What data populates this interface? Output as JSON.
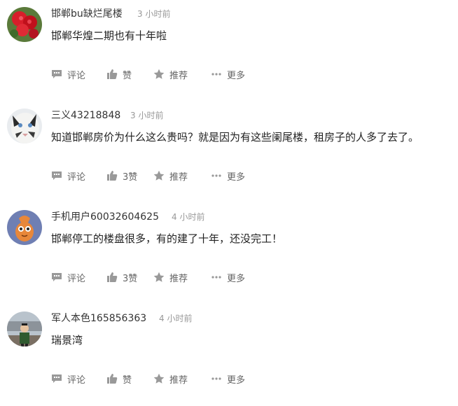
{
  "comments": [
    {
      "username": "邯郸bu缺烂尾楼",
      "time": "3 小时前",
      "content": "邯郸华煌二期也有十年啦",
      "actions": {
        "comment": "评论",
        "like": "赞",
        "recommend": "推荐",
        "more": "更多"
      }
    },
    {
      "username": "三义43218848",
      "time": "3 小时前",
      "content": "知道邯郸房价为什么这么贵吗？就是因为有这些阑尾楼，租房子的人多了去了。",
      "actions": {
        "comment": "评论",
        "like": "3赞",
        "recommend": "推荐",
        "more": "更多"
      }
    },
    {
      "username": "手机用户60032604625",
      "time": "4 小时前",
      "content": "邯郸停工的楼盘很多，有的建了十年，还没完工！",
      "actions": {
        "comment": "评论",
        "like": "3赞",
        "recommend": "推荐",
        "more": "更多"
      }
    },
    {
      "username": "军人本色165856363",
      "time": "4 小时前",
      "content": "瑞景湾",
      "actions": {
        "comment": "评论",
        "like": "赞",
        "recommend": "推荐",
        "more": "更多"
      }
    }
  ],
  "icons": {
    "comment": "comment-bubble-icon",
    "like": "thumbs-up-icon",
    "recommend": "star-icon",
    "more": "ellipsis-icon"
  },
  "colors": {
    "icon": "#999999",
    "text_muted": "#999999",
    "action_text": "#666666"
  }
}
